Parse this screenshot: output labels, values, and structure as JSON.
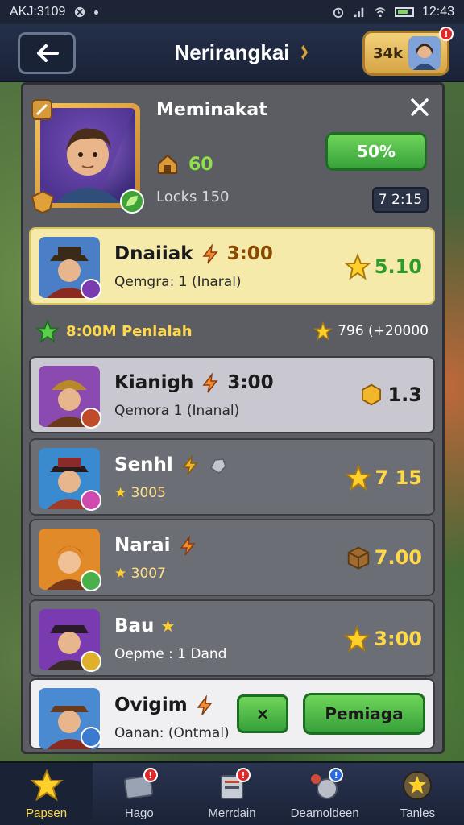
{
  "status_bar": {
    "left_text": "AKJ:3109",
    "time": "12:43"
  },
  "header": {
    "title": "Nerirangkai",
    "profile_value": "34k",
    "profile_badge": "!"
  },
  "hero": {
    "title": "Meminakat",
    "level": "60",
    "locks": "Locks 150",
    "progress_label": "50%",
    "progress": 0.5,
    "timer": "7 2:15"
  },
  "rows": [
    {
      "name": "Dnaiiak",
      "name_extra": "3:00",
      "sub": "Qemgra: 1 (Inaral)",
      "value": "5.10",
      "value_icon": "star-icon"
    },
    {
      "name": "Kianigh",
      "name_extra": "3:00",
      "sub": "Qemora 1 (Inanal)",
      "value": "1.3",
      "value_icon": "gem-icon"
    },
    {
      "name": "Senhl",
      "name_extra": "",
      "sub": "3005",
      "value": "7 15",
      "value_icon": "star-icon"
    },
    {
      "name": "Narai",
      "name_extra": "",
      "sub": "3007",
      "value": "7.00",
      "value_icon": "crate-icon"
    },
    {
      "name": "Bau",
      "name_extra": "",
      "sub": "Oepme : 1 Dand",
      "value": "3:00",
      "value_icon": "star-icon"
    },
    {
      "name": "Ovigim",
      "name_extra": "",
      "sub": "Oanan: (Ontmal)",
      "value": "",
      "value_icon": ""
    }
  ],
  "group": {
    "left": "8:00M Penlalah",
    "right": "796 (+20000"
  },
  "buttons": {
    "x_label": "×",
    "action_label": "Pemiaga"
  },
  "nav": [
    {
      "label": "Papsen"
    },
    {
      "label": "Hago"
    },
    {
      "label": "Merrdain"
    },
    {
      "label": "Deamoldeen"
    },
    {
      "label": "Tanles"
    }
  ],
  "colors": {
    "accent_green": "#37a13a",
    "gold": "#ffd84a",
    "selected_row": "#f5eaaa"
  }
}
